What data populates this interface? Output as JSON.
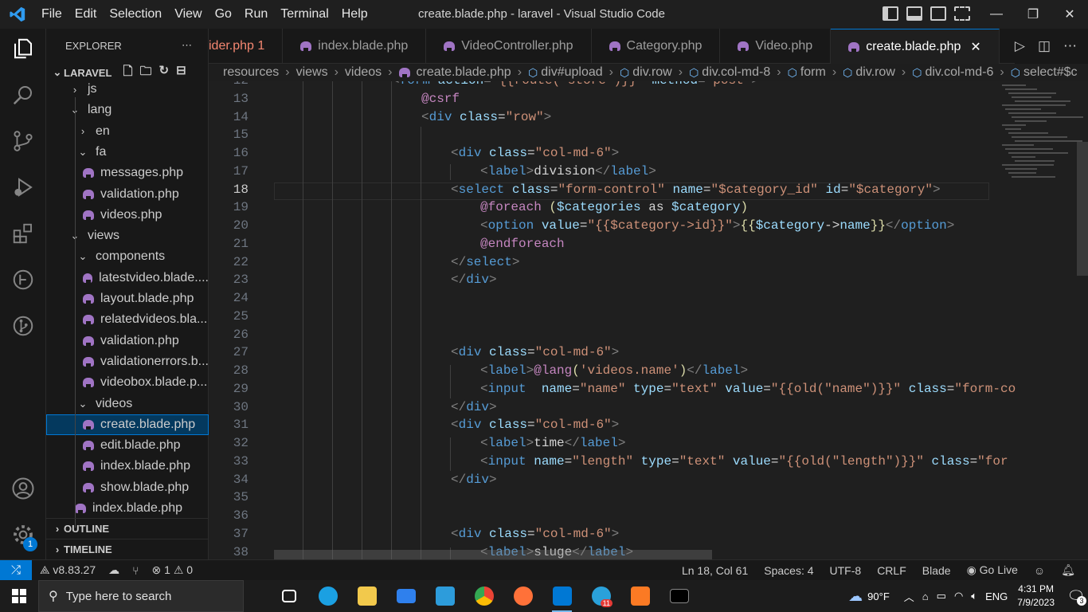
{
  "titlebar": {
    "menus": [
      "File",
      "Edit",
      "Selection",
      "View",
      "Go",
      "Run",
      "Terminal",
      "Help"
    ],
    "title": "create.blade.php - laravel - Visual Studio Code"
  },
  "activity": {
    "badge": "1"
  },
  "explorer": {
    "header": "EXPLORER",
    "root": "LARAVEL",
    "items": [
      {
        "label": "js",
        "type": "folder",
        "open": false,
        "depth": 2
      },
      {
        "label": "lang",
        "type": "folder",
        "open": true,
        "depth": 2
      },
      {
        "label": "en",
        "type": "folder",
        "open": false,
        "depth": 3
      },
      {
        "label": "fa",
        "type": "folder",
        "open": true,
        "depth": 3
      },
      {
        "label": "messages.php",
        "type": "file",
        "depth": 4
      },
      {
        "label": "validation.php",
        "type": "file",
        "depth": 4
      },
      {
        "label": "videos.php",
        "type": "file",
        "depth": 4
      },
      {
        "label": "views",
        "type": "folder",
        "open": true,
        "depth": 2
      },
      {
        "label": "components",
        "type": "folder",
        "open": true,
        "depth": 3
      },
      {
        "label": "latestvideo.blade....",
        "type": "file",
        "depth": 4
      },
      {
        "label": "layout.blade.php",
        "type": "file",
        "depth": 4
      },
      {
        "label": "relatedvideos.bla...",
        "type": "file",
        "depth": 4
      },
      {
        "label": "validation.php",
        "type": "file",
        "depth": 4
      },
      {
        "label": "validationerrors.b...",
        "type": "file",
        "depth": 4
      },
      {
        "label": "videobox.blade.p...",
        "type": "file",
        "depth": 4
      },
      {
        "label": "videos",
        "type": "folder",
        "open": true,
        "depth": 3
      },
      {
        "label": "create.blade.php",
        "type": "file",
        "depth": 4,
        "selected": true
      },
      {
        "label": "edit.blade.php",
        "type": "file",
        "depth": 4
      },
      {
        "label": "index.blade.php",
        "type": "file",
        "depth": 4
      },
      {
        "label": "show.blade.php",
        "type": "file",
        "depth": 4
      },
      {
        "label": "index.blade.php",
        "type": "file",
        "depth": 3
      }
    ],
    "outline": "OUTLINE",
    "timeline": "TIMELINE"
  },
  "tabs": [
    {
      "label": "ider.php",
      "suffix": "1",
      "error": true
    },
    {
      "label": "index.blade.php"
    },
    {
      "label": "VideoController.php"
    },
    {
      "label": "Category.php"
    },
    {
      "label": "Video.php"
    },
    {
      "label": "create.blade.php",
      "active": true
    }
  ],
  "breadcrumbs": [
    "resources",
    "views",
    "videos",
    "create.blade.php",
    "div#upload",
    "div.row",
    "div.col-md-8",
    "form",
    "div.row",
    "div.col-md-6",
    "select#$c"
  ],
  "editor": {
    "current_line": 18,
    "lines": [
      {
        "n": 12,
        "indent": 0,
        "html": "<form action=\"{{route('store')}}\" method=\"post\">"
      },
      {
        "n": 13,
        "indent": 1
      },
      {
        "n": 14,
        "indent": 1
      },
      {
        "n": 15
      },
      {
        "n": 16
      },
      {
        "n": 17
      },
      {
        "n": 18
      },
      {
        "n": 19
      },
      {
        "n": 20
      },
      {
        "n": 21
      },
      {
        "n": 22
      },
      {
        "n": 23
      },
      {
        "n": 24
      },
      {
        "n": 25
      },
      {
        "n": 26
      },
      {
        "n": 27
      },
      {
        "n": 28
      },
      {
        "n": 29
      },
      {
        "n": 30
      },
      {
        "n": 31
      },
      {
        "n": 32
      },
      {
        "n": 33
      },
      {
        "n": 34
      },
      {
        "n": 35
      },
      {
        "n": 36
      },
      {
        "n": 37
      },
      {
        "n": 38
      }
    ]
  },
  "status": {
    "version": "v8.83.27",
    "errors": "1",
    "warnings": "0",
    "position": "Ln 18, Col 61",
    "spaces": "Spaces: 4",
    "encoding": "UTF-8",
    "eol": "CRLF",
    "language": "Blade",
    "golive": "Go Live"
  },
  "taskbar": {
    "search_placeholder": "Type here to search",
    "temp": "90°F",
    "lang": "ENG",
    "time": "4:31 PM",
    "date": "7/9/2023",
    "notif_count": "3",
    "telegram_badge": "11"
  },
  "colors": {
    "accent": "#0078d4",
    "php_icon": "#a074c4"
  }
}
